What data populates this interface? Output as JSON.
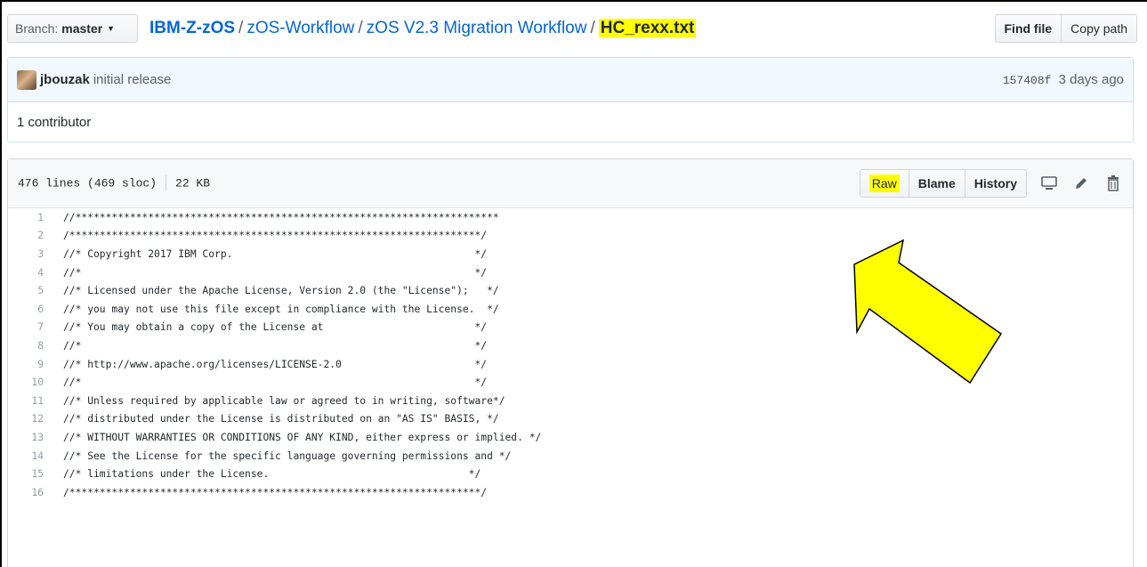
{
  "branch": {
    "label": "Branch:",
    "name": "master"
  },
  "breadcrumb": {
    "repo": "IBM-Z-zOS",
    "parts": [
      "zOS-Workflow",
      "zOS V2.3 Migration Workflow"
    ],
    "file": "HC_rexx.txt",
    "separator": "/"
  },
  "header_buttons": {
    "find_file": "Find file",
    "copy_path": "Copy path"
  },
  "commit": {
    "author": "jbouzak",
    "message": "initial release",
    "sha": "157408f",
    "time": "3 days ago"
  },
  "contributors": {
    "count": "1",
    "label": "contributor"
  },
  "file": {
    "lines": "476 lines (469 sloc)",
    "size": "22 KB",
    "buttons": {
      "raw": "Raw",
      "blame": "Blame",
      "history": "History"
    },
    "icons": [
      "desktop-icon",
      "pencil-icon",
      "trash-icon"
    ]
  },
  "code_lines": [
    {
      "n": "1",
      "t": "//**********************************************************************"
    },
    {
      "n": "2",
      "t": "/********************************************************************/"
    },
    {
      "n": "3",
      "t": "//* Copyright 2017 IBM Corp.                                        */"
    },
    {
      "n": "4",
      "t": "//*                                                                 */"
    },
    {
      "n": "5",
      "t": "//* Licensed under the Apache License, Version 2.0 (the \"License\");   */"
    },
    {
      "n": "6",
      "t": "//* you may not use this file except in compliance with the License.  */"
    },
    {
      "n": "7",
      "t": "//* You may obtain a copy of the License at                         */"
    },
    {
      "n": "8",
      "t": "//*                                                                 */"
    },
    {
      "n": "9",
      "t": "//* http://www.apache.org/licenses/LICENSE-2.0                      */"
    },
    {
      "n": "10",
      "t": "//*                                                                 */"
    },
    {
      "n": "11",
      "t": "//* Unless required by applicable law or agreed to in writing, software*/"
    },
    {
      "n": "12",
      "t": "//* distributed under the License is distributed on an \"AS IS\" BASIS, */"
    },
    {
      "n": "13",
      "t": "//* WITHOUT WARRANTIES OR CONDITIONS OF ANY KIND, either express or implied. */"
    },
    {
      "n": "14",
      "t": "//* See the License for the specific language governing permissions and */"
    },
    {
      "n": "15",
      "t": "//* limitations under the License.                                 */"
    },
    {
      "n": "16",
      "t": "/********************************************************************/"
    }
  ],
  "colors": {
    "highlight": "#ffff00",
    "link": "#0366d6",
    "arrow_fill": "#ffff00"
  }
}
